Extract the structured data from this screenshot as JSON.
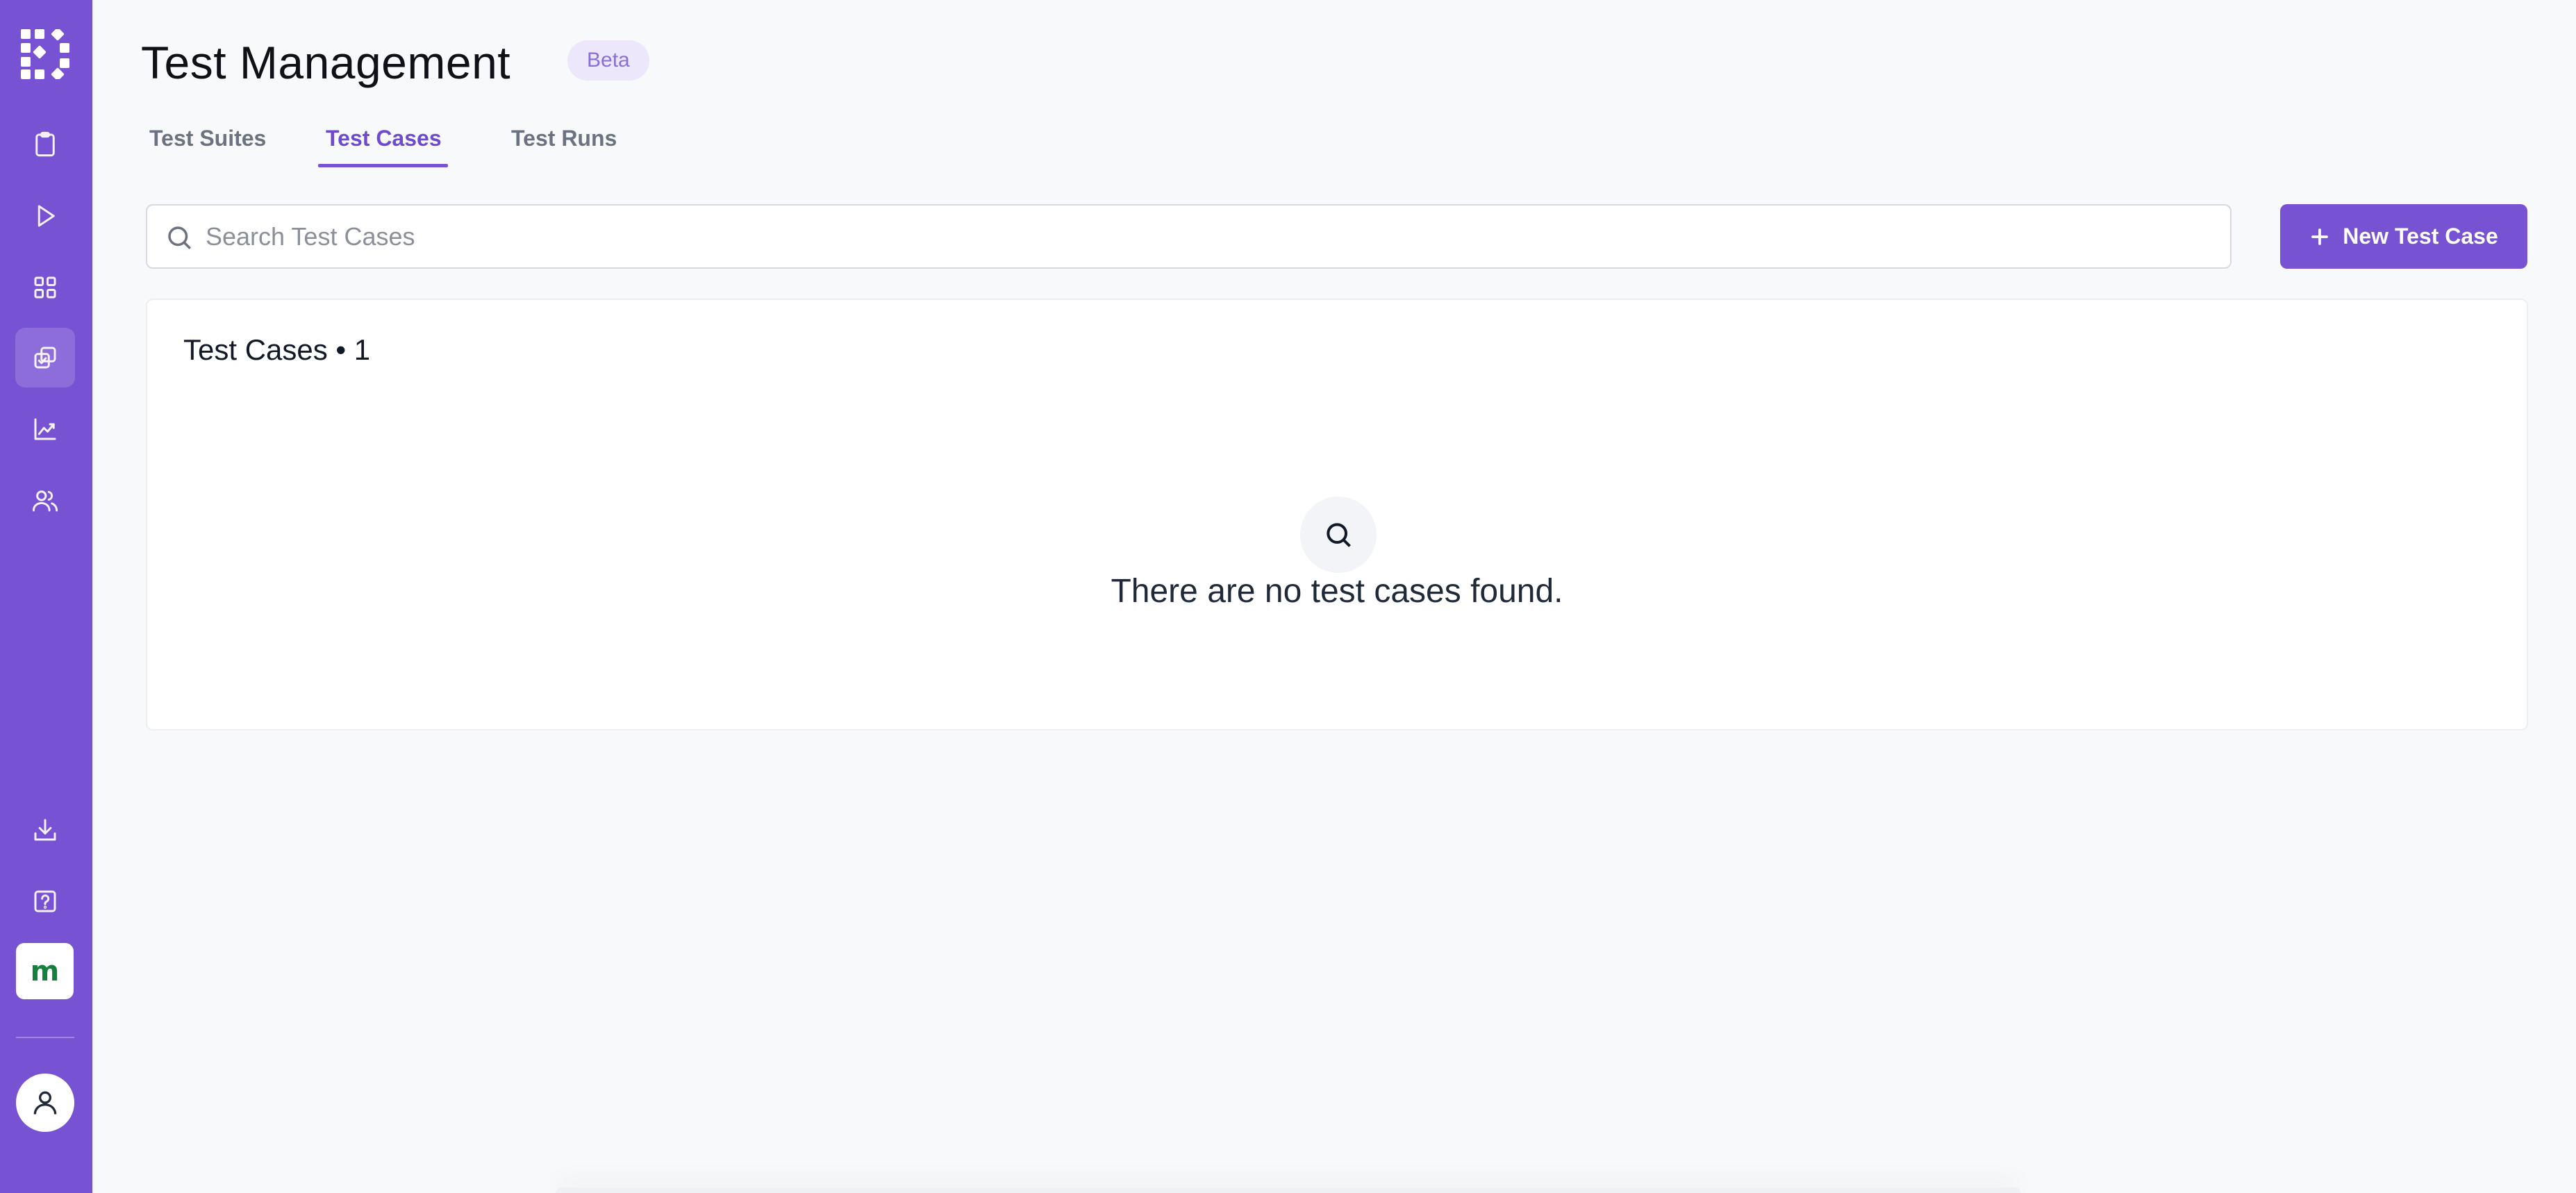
{
  "header": {
    "title": "Test Management",
    "badge": "Beta"
  },
  "tabs": [
    {
      "label": "Test Suites",
      "active": false
    },
    {
      "label": "Test Cases",
      "active": true
    },
    {
      "label": "Test Runs",
      "active": false
    }
  ],
  "search": {
    "placeholder": "Search Test Cases",
    "value": ""
  },
  "actions": {
    "new_test_case_label": "New Test Case"
  },
  "card": {
    "title": "Test Cases • 1",
    "empty_message": "There are no test cases found."
  },
  "sidebar": {
    "items": [
      {
        "icon": "clipboard-icon"
      },
      {
        "icon": "play-icon"
      },
      {
        "icon": "grid-icon"
      },
      {
        "icon": "test-management-icon",
        "active": true
      },
      {
        "icon": "chart-icon"
      },
      {
        "icon": "users-icon"
      },
      {
        "icon": "download-icon"
      },
      {
        "icon": "help-icon"
      }
    ],
    "workspace_initial": "m"
  },
  "colors": {
    "brand": "#7752d3",
    "active_tab": "#6d4ad0",
    "badge_bg": "#ece7fb",
    "workspace_text": "#15803d"
  }
}
